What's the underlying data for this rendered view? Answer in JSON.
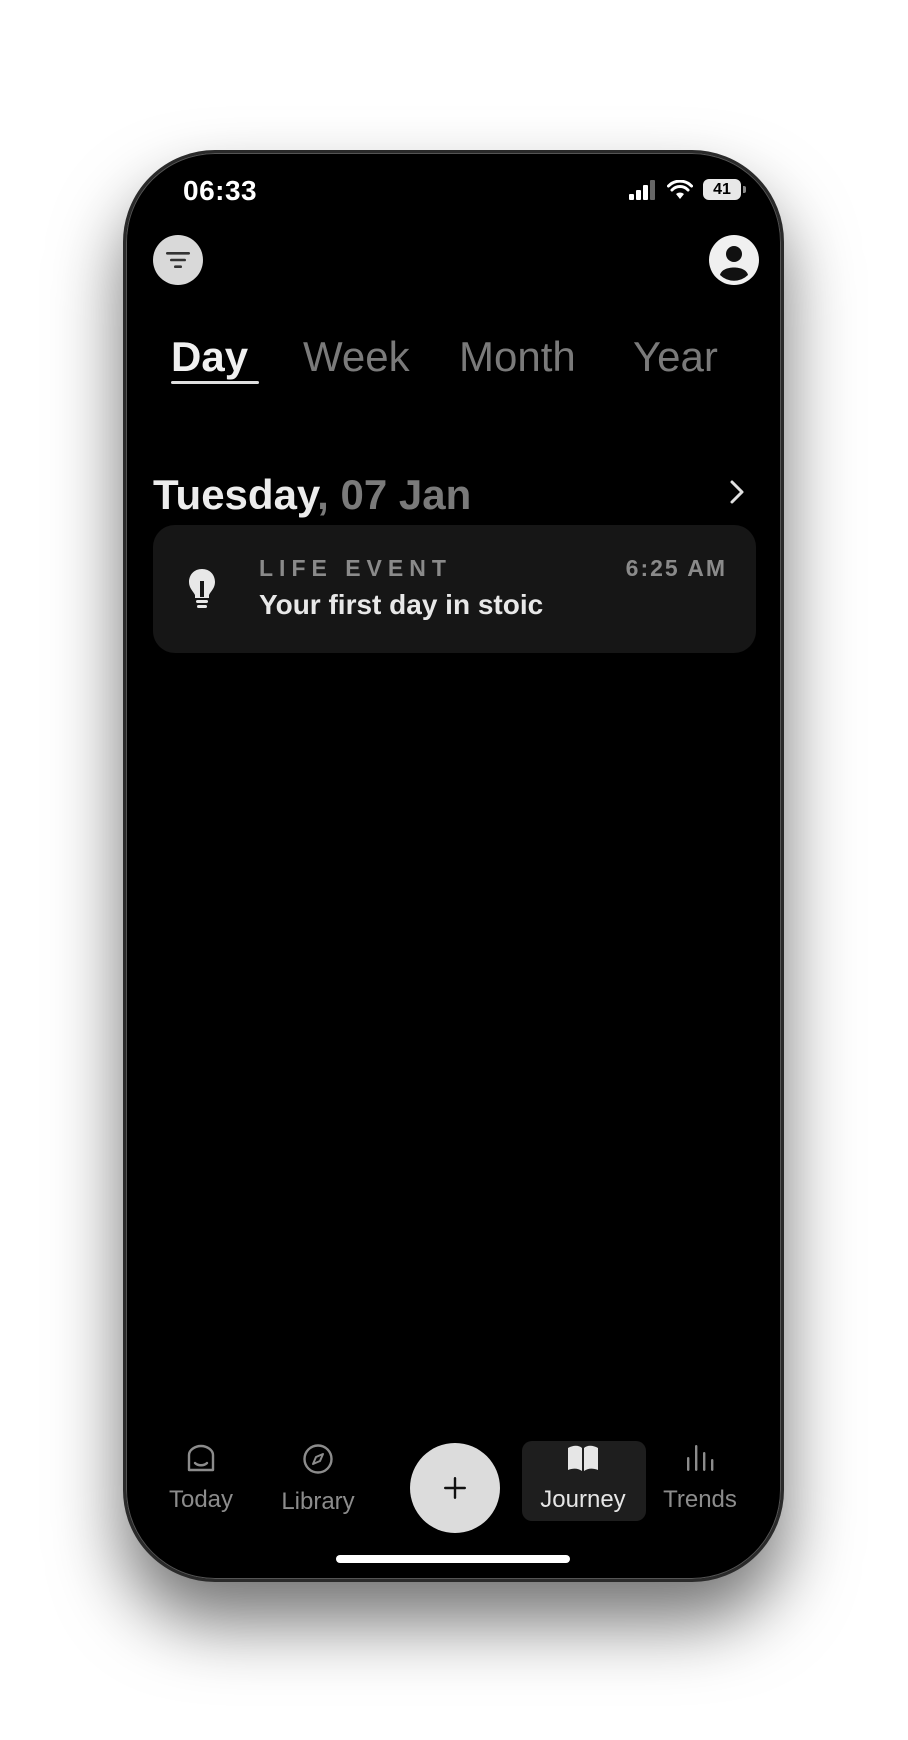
{
  "status_bar": {
    "time": "06:33",
    "battery": "41"
  },
  "tabs": [
    {
      "label": "Day",
      "active": true
    },
    {
      "label": "Week",
      "active": false
    },
    {
      "label": "Month",
      "active": false
    },
    {
      "label": "Year",
      "active": false
    }
  ],
  "date_heading": {
    "weekday": "Tuesday",
    "date": ", 07 Jan"
  },
  "entry": {
    "category": "LIFE EVENT",
    "time": "6:25 AM",
    "title": "Your first day in stoic",
    "icon": "lightbulb-icon"
  },
  "bottom_nav": [
    {
      "label": "Today",
      "icon": "home-icon",
      "active": false
    },
    {
      "label": "Library",
      "icon": "compass-icon",
      "active": false
    },
    {
      "label": "Journey",
      "icon": "book-icon",
      "active": true
    },
    {
      "label": "Trends",
      "icon": "bars-icon",
      "active": false
    }
  ],
  "colors": {
    "background": "#000000",
    "card": "#161616",
    "text_primary": "#ececec",
    "text_muted": "#7a7a7a",
    "fab": "#dcdcdc"
  }
}
